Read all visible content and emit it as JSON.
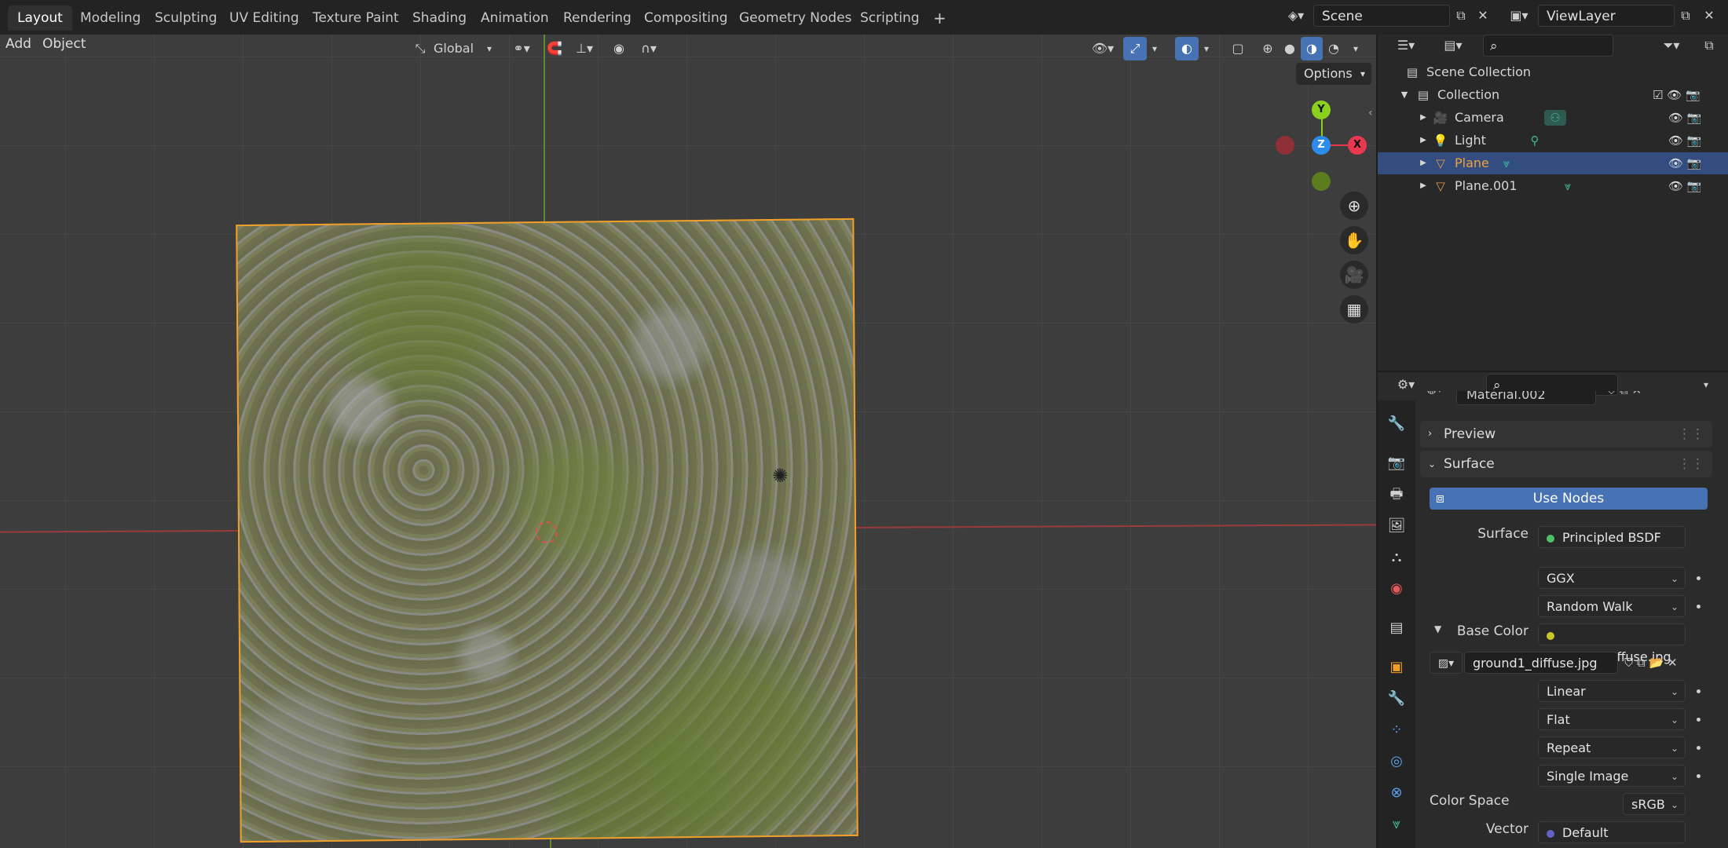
{
  "workspaces": [
    "Layout",
    "Modeling",
    "Sculpting",
    "UV Editing",
    "Texture Paint",
    "Shading",
    "Animation",
    "Rendering",
    "Compositing",
    "Geometry Nodes",
    "Scripting"
  ],
  "add_workspace": "+",
  "scene": {
    "name": "Scene",
    "view_layer": "ViewLayer"
  },
  "viewport": {
    "menu": {
      "add": "Add",
      "object": "Object"
    },
    "transform_orientation": "Global",
    "options_label": "Options",
    "gizmo": {
      "x": "X",
      "y": "Y",
      "z": "Z"
    }
  },
  "outliner": {
    "search_placeholder": "",
    "scene_collection": "Scene Collection",
    "collection": "Collection",
    "items": [
      {
        "name": "Camera",
        "selected": false
      },
      {
        "name": "Light",
        "selected": false
      },
      {
        "name": "Plane",
        "selected": true
      },
      {
        "name": "Plane.001",
        "selected": false
      }
    ]
  },
  "properties": {
    "search_placeholder": "",
    "material_name": "Material.002",
    "panels": {
      "preview": "Preview",
      "surface": "Surface"
    },
    "use_nodes": "Use Nodes",
    "surface_label": "Surface",
    "surface_shader": "Principled BSDF",
    "distribution": "GGX",
    "subsurface_method": "Random Walk",
    "base_color_label": "Base Color",
    "base_color_texture": "ground1_diffuse.jpg",
    "image_name": "ground1_diffuse.jpg",
    "interpolation": "Linear",
    "projection": "Flat",
    "extension": "Repeat",
    "source": "Single Image",
    "color_space_label": "Color Space",
    "color_space": "sRGB",
    "vector_label": "Vector",
    "vector_value": "Default"
  },
  "colors": {
    "accent": "#4772b3",
    "selected_outline": "#f29f2a",
    "x_axis": "#e8384f",
    "y_axis": "#8bd01f",
    "z_axis": "#2d8ceb"
  }
}
